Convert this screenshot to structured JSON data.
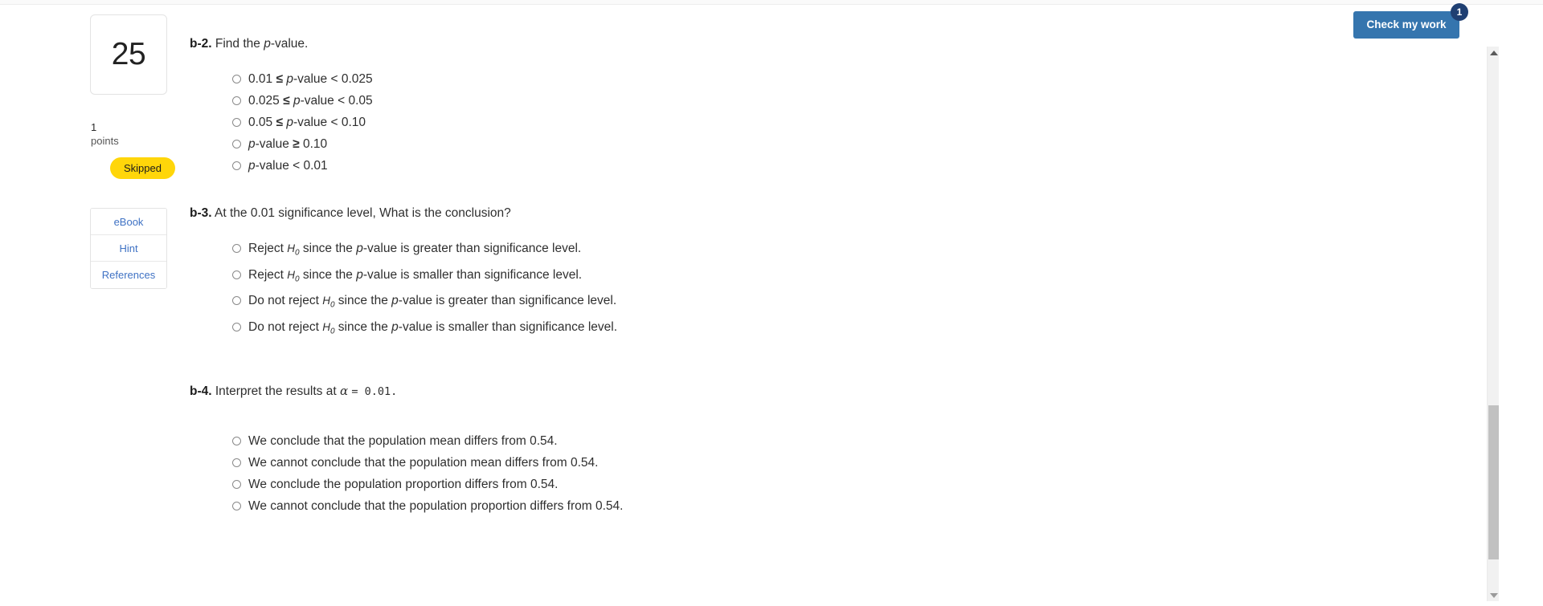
{
  "question": {
    "number": "25",
    "points_value": "1",
    "points_label": "points",
    "status_badge": "Skipped"
  },
  "tools": [
    {
      "label": "eBook",
      "name": "ebook"
    },
    {
      "label": "Hint",
      "name": "hint"
    },
    {
      "label": "References",
      "name": "references"
    }
  ],
  "check_my_work": {
    "label": "Check my work",
    "badge_count": "1",
    "button_color": "#3575ae",
    "badge_color": "#1f3f72"
  },
  "parts": [
    {
      "id": "b-2",
      "label": "b-2.",
      "prompt_before": "Find the ",
      "prompt_italic": "p",
      "prompt_after": "-value.",
      "options": [
        "0.01 ≤ p-value < 0.025",
        "0.025 ≤ p-value < 0.05",
        "0.05 ≤ p-value < 0.10",
        "p-value ≥ 0.10",
        "p-value < 0.01"
      ]
    },
    {
      "id": "b-3",
      "label": "b-3.",
      "prompt": "At the 0.01 significance level, What is the conclusion?",
      "options": [
        "Reject H0 since the p-value is greater than significance level.",
        "Reject H0 since the p-value is smaller than significance level.",
        "Do not reject H0 since the p-value is greater than significance level.",
        "Do not reject H0 since the p-value is smaller than significance level."
      ]
    },
    {
      "id": "b-4",
      "label": "b-4.",
      "prompt_before": "Interpret the results at ",
      "prompt_symbol": "α",
      "prompt_mono": "= 0.01.",
      "options": [
        "We conclude that the population mean differs from 0.54.",
        "We cannot conclude that the population mean differs from 0.54.",
        "We conclude the population proportion differs from 0.54.",
        "We cannot conclude that the population proportion differs from 0.54."
      ]
    }
  ],
  "scrollbar": {
    "up_arrow": "scroll-up",
    "down_arrow": "scroll-down"
  }
}
